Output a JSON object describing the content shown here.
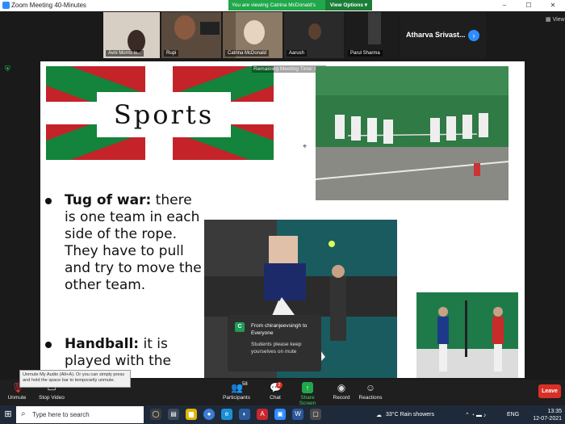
{
  "window": {
    "title": "Zoom Meeting 40-Minutes",
    "controls": [
      "–",
      "☐",
      "✕"
    ]
  },
  "banner": {
    "message": "You are viewing Catrina McDonald's screen",
    "view_options": "View Options ▾"
  },
  "participants_strip": {
    "tiles": [
      {
        "name": "Avni Morris lo..."
      },
      {
        "name": "Rupi"
      },
      {
        "name": "Catrina McDonald"
      },
      {
        "name": "Aarush"
      },
      {
        "name": "Parul Sharma"
      }
    ],
    "active_name": "Atharva   Srivast...",
    "view_label": "View"
  },
  "slide": {
    "title_text": "Sports",
    "timer": "Remaining Meeting Time: 03:2",
    "bullets": [
      {
        "term": "Tug of war:",
        "text": " there is one team in each side of the rope. They have to pull and try to move the other team."
      },
      {
        "term": "Handball:",
        "text": " it is played with the hand in a"
      }
    ]
  },
  "chat_toast": {
    "avatar_letter": "C",
    "from": "From chiranjeevsingh to Everyone",
    "message": "Students please keep yourselves on mute"
  },
  "tooltip": "Unmute My Audio (Alt+A). Or you can simply press and hold the space bar to temporarily unmute.",
  "toolbar": {
    "unmute": "Unmute",
    "stop_video": "Stop Video",
    "participants": "Participants",
    "participants_count": "58",
    "chat": "Chat",
    "chat_badge": "2",
    "share_screen": "Share Screen",
    "record": "Record",
    "reactions": "Reactions",
    "leave": "Leave"
  },
  "taskbar": {
    "search_placeholder": "Type here to search",
    "weather": "33°C  Rain showers",
    "language": "ENG",
    "time": "13:35",
    "date": "12-07-2021"
  },
  "colors": {
    "accent": "#2d8cff",
    "share_green": "#20a84a",
    "leave_red": "#d93025",
    "flag_red": "#c4232a",
    "flag_green": "#14833b"
  }
}
